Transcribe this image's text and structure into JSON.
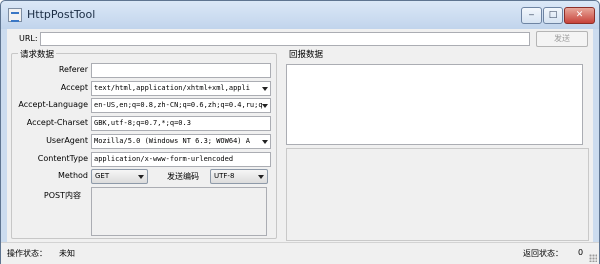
{
  "window": {
    "title": "HttpPostTool"
  },
  "caption_buttons": {
    "minimize": "‒",
    "maximize": "□",
    "close": "✕"
  },
  "url_bar": {
    "label": "URL:",
    "value": "",
    "send_label": "发送"
  },
  "request": {
    "group_title": "请求数据",
    "referer": {
      "label": "Referer",
      "value": ""
    },
    "accept": {
      "label": "Accept",
      "value": "text/html,application/xhtml+xml,appli"
    },
    "accept_language": {
      "label": "Accept-Language",
      "value": "en-US,en;q=0.8,zh-CN;q=0.6,zh;q=0.4,ru;q"
    },
    "accept_charset": {
      "label": "Accept-Charset",
      "value": "GBK,utf-8;q=0.7,*;q=0.3"
    },
    "user_agent": {
      "label": "UserAgent",
      "value": "Mozilla/5.0 (Windows NT 6.3; WOW64) A"
    },
    "content_type": {
      "label": "ContentType",
      "value": "application/x-www-form-urlencoded"
    },
    "method": {
      "label": "Method",
      "value": "GET"
    },
    "encoding": {
      "label": "发送编码",
      "value": "UTF-8"
    },
    "post_content": {
      "label": "POST内容",
      "value": ""
    }
  },
  "response": {
    "group_title": "回报数据",
    "headers": "",
    "body": ""
  },
  "status_bar": {
    "op_status_label": "操作状态：",
    "op_status_value": "未知",
    "return_status_label": "返回状态：",
    "return_status_value": "0"
  }
}
